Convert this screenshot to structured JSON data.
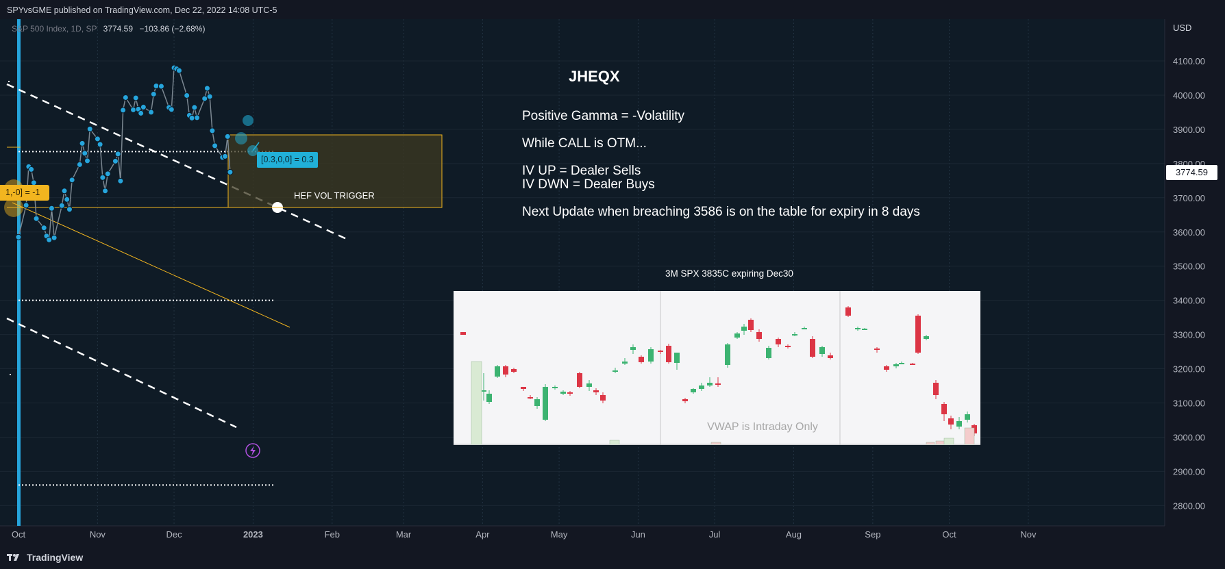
{
  "header": {
    "publish_line": "SPYvsGME published on TradingView.com, Dec 22, 2022 14:08 UTC-5"
  },
  "legend": {
    "symbol": "S&P 500 Index, 1D, SP",
    "price": "3774.59",
    "change": "−103.86 (−2.68%)"
  },
  "axis": {
    "currency": "USD",
    "current_price": "3774.59"
  },
  "annotations": {
    "title": "JHEQX",
    "lines": [
      "Positive Gamma = -Volatility",
      "While CALL is OTM...",
      "IV UP = Dealer Sells",
      "IV DWN = Dealer Buys",
      "Next Update when breaching 3586 is on the table for expiry in 8 days"
    ],
    "zone_label": "HEF VOL TRIGGER",
    "cyan_badge": "[0.3,0,0] = 0.3",
    "yellow_badge": "1,-0] = -1",
    "inset_caption": "3M SPX 3835C expiring Dec30",
    "inset_note": "VWAP is Intraday Only"
  },
  "footer": {
    "brand": "TradingView"
  },
  "colors": {
    "background": "#131722",
    "price_line": "#26a5dc",
    "accent_cyan": "#21b0d8",
    "accent_yellow": "#f2b51f",
    "up_candle": "#3cb371",
    "down_candle": "#dc3545"
  },
  "chart_data": {
    "type": "line",
    "title": "S&P 500 Index, 1D, SP",
    "ylabel": "USD",
    "ylim": [
      2750,
      4150
    ],
    "yticks": [
      4100,
      4000,
      3900,
      3800,
      3700,
      3600,
      3500,
      3400,
      3300,
      3200,
      3100,
      3000,
      2900,
      2800
    ],
    "ytick_labels": [
      "4100.00",
      "4000.00",
      "3900.00",
      "3800.00",
      "3700.00",
      "3600.00",
      "3500.00",
      "3400.00",
      "3300.00",
      "3200.00",
      "3100.00",
      "3000.00",
      "2900.00",
      "2800.00"
    ],
    "xtick_labels": [
      "Oct",
      "Nov",
      "Dec",
      "2023",
      "Feb",
      "Mar",
      "Apr",
      "May",
      "Jun",
      "Jul",
      "Aug",
      "Sep",
      "Oct",
      "Nov"
    ],
    "xtick_days": [
      0,
      31,
      61,
      92,
      123,
      151,
      182,
      212,
      243,
      273,
      304,
      335,
      365,
      396
    ],
    "series": [
      {
        "values": [
          {
            "x": "2022-09-30",
            "y": 3585
          },
          {
            "x": "2022-10-03",
            "y": 3678
          },
          {
            "x": "2022-10-04",
            "y": 3791
          },
          {
            "x": "2022-10-05",
            "y": 3783
          },
          {
            "x": "2022-10-06",
            "y": 3744
          },
          {
            "x": "2022-10-07",
            "y": 3639
          },
          {
            "x": "2022-10-10",
            "y": 3612
          },
          {
            "x": "2022-10-11",
            "y": 3588
          },
          {
            "x": "2022-10-12",
            "y": 3577
          },
          {
            "x": "2022-10-13",
            "y": 3669
          },
          {
            "x": "2022-10-14",
            "y": 3583
          },
          {
            "x": "2022-10-17",
            "y": 3677
          },
          {
            "x": "2022-10-18",
            "y": 3720
          },
          {
            "x": "2022-10-19",
            "y": 3695
          },
          {
            "x": "2022-10-20",
            "y": 3666
          },
          {
            "x": "2022-10-21",
            "y": 3752
          },
          {
            "x": "2022-10-24",
            "y": 3797
          },
          {
            "x": "2022-10-25",
            "y": 3859
          },
          {
            "x": "2022-10-26",
            "y": 3830
          },
          {
            "x": "2022-10-27",
            "y": 3808
          },
          {
            "x": "2022-10-28",
            "y": 3901
          },
          {
            "x": "2022-10-31",
            "y": 3872
          },
          {
            "x": "2022-11-01",
            "y": 3856
          },
          {
            "x": "2022-11-02",
            "y": 3759
          },
          {
            "x": "2022-11-03",
            "y": 3720
          },
          {
            "x": "2022-11-04",
            "y": 3770
          },
          {
            "x": "2022-11-07",
            "y": 3807
          },
          {
            "x": "2022-11-08",
            "y": 3828
          },
          {
            "x": "2022-11-09",
            "y": 3749
          },
          {
            "x": "2022-11-10",
            "y": 3956
          },
          {
            "x": "2022-11-11",
            "y": 3993
          },
          {
            "x": "2022-11-14",
            "y": 3957
          },
          {
            "x": "2022-11-15",
            "y": 3992
          },
          {
            "x": "2022-11-16",
            "y": 3959
          },
          {
            "x": "2022-11-17",
            "y": 3947
          },
          {
            "x": "2022-11-18",
            "y": 3965
          },
          {
            "x": "2022-11-21",
            "y": 3950
          },
          {
            "x": "2022-11-22",
            "y": 4003
          },
          {
            "x": "2022-11-23",
            "y": 4027
          },
          {
            "x": "2022-11-25",
            "y": 4026
          },
          {
            "x": "2022-11-28",
            "y": 3964
          },
          {
            "x": "2022-11-29",
            "y": 3958
          },
          {
            "x": "2022-11-30",
            "y": 4080
          },
          {
            "x": "2022-12-01",
            "y": 4077
          },
          {
            "x": "2022-12-02",
            "y": 4072
          },
          {
            "x": "2022-12-05",
            "y": 3999
          },
          {
            "x": "2022-12-06",
            "y": 3941
          },
          {
            "x": "2022-12-07",
            "y": 3933
          },
          {
            "x": "2022-12-08",
            "y": 3964
          },
          {
            "x": "2022-12-09",
            "y": 3934
          },
          {
            "x": "2022-12-12",
            "y": 3990
          },
          {
            "x": "2022-12-13",
            "y": 4020
          },
          {
            "x": "2022-12-14",
            "y": 3996
          },
          {
            "x": "2022-12-15",
            "y": 3896
          },
          {
            "x": "2022-12-16",
            "y": 3852
          },
          {
            "x": "2022-12-19",
            "y": 3818
          },
          {
            "x": "2022-12-20",
            "y": 3821
          },
          {
            "x": "2022-12-21",
            "y": 3879
          },
          {
            "x": "2022-12-22",
            "y": 3775
          }
        ]
      }
    ]
  },
  "inset_chart_data": {
    "type": "bar",
    "title": "3M SPX 3835C expiring Dec30"
  }
}
